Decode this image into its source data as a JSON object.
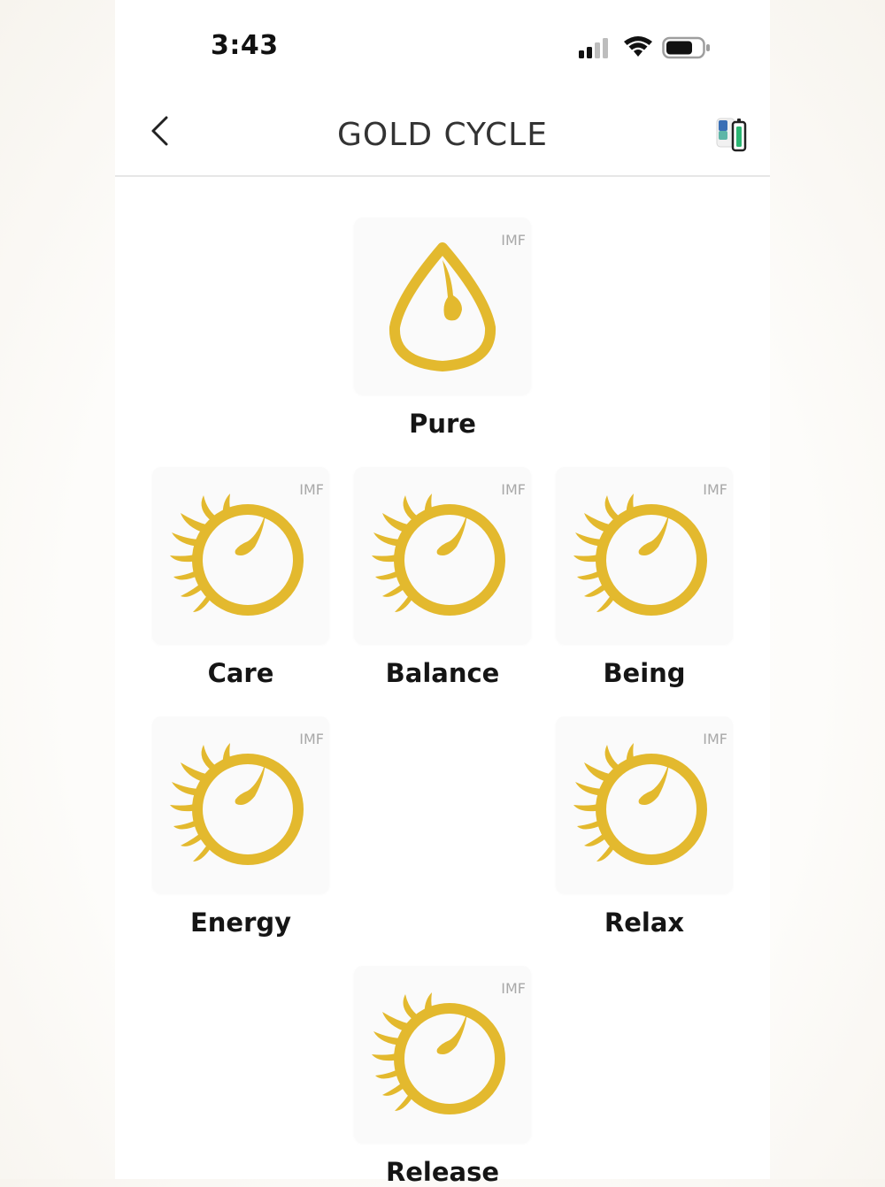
{
  "status": {
    "time": "3:43"
  },
  "header": {
    "title": "GOLD CYCLE"
  },
  "icons": {
    "back": "chevron-left-icon",
    "device": "device-battery-icon",
    "pure": "water-drop-icon",
    "cycle": "sun-cycle-icon"
  },
  "colors": {
    "gold": "#E3B92E"
  },
  "tiles": [
    {
      "label": "Pure",
      "badge": "IMF"
    },
    {
      "label": "Care",
      "badge": "IMF"
    },
    {
      "label": "Balance",
      "badge": "IMF"
    },
    {
      "label": "Being",
      "badge": "IMF"
    },
    {
      "label": "Energy",
      "badge": "IMF"
    },
    {
      "label": "Relax",
      "badge": "IMF"
    },
    {
      "label": "Release",
      "badge": "IMF"
    }
  ]
}
